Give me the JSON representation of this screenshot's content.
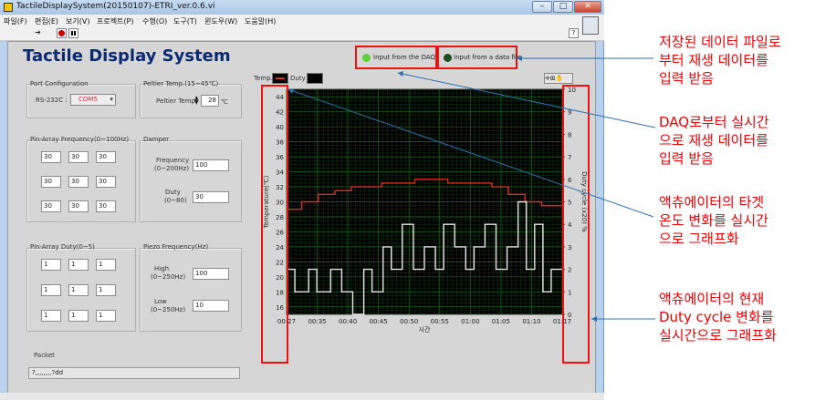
{
  "window": {
    "title": "TactileDisplaySystem(20150107)-ETRI_ver.0.6.vi",
    "min": "–",
    "max": "□",
    "close": "✕"
  },
  "menu": [
    "파일(F)",
    "편집(E)",
    "보기(V)",
    "프로젝트(P)",
    "수행(O)",
    "도구(T)",
    "윈도우(W)",
    "도움말(H)"
  ],
  "toolbar": {
    "run_icon": "arrow-run-icon",
    "stop_icon": "stop-icon",
    "pause_icon": "pause-icon",
    "help_icon": "help-icon"
  },
  "app_title": "Tactile Display System",
  "input_daq": {
    "label": "Input from the DAQ",
    "led_color": "#5fd23a"
  },
  "input_file": {
    "label": "Input from a data file",
    "led_color": "#1e4d1e"
  },
  "port_config": {
    "title": "Port Configuration",
    "label": "RS-232C :",
    "value": "COM5"
  },
  "peltier": {
    "title": "Peltier Temp.(15~45℃)",
    "label": "Peltier Temp.",
    "value": "28",
    "unit": "℃"
  },
  "pin_freq": {
    "title": "Pin-Array Frequency(0~100Hz)",
    "values": [
      "30",
      "30",
      "30",
      "30",
      "30",
      "30",
      "30",
      "30",
      "30"
    ]
  },
  "damper": {
    "title": "Damper",
    "freq_label1": "Frequency",
    "freq_label2": "(0~200Hz)",
    "freq_value": "100",
    "duty_label1": "Duty",
    "duty_label2": "(0~80)",
    "duty_value": "30"
  },
  "pin_duty": {
    "title": "Pin-Array Duty(0~5)",
    "values": [
      "1",
      "1",
      "1",
      "1",
      "1",
      "1",
      "1",
      "1",
      "1"
    ]
  },
  "piezo": {
    "title": "Piezo Frequency(Hz)",
    "high_label1": "High",
    "high_label2": "(0~250Hz)",
    "high_value": "100",
    "low_label1": "Low",
    "low_label2": "(0~250Hz)",
    "low_value": "10"
  },
  "packet": {
    "title": "Packet",
    "value": "?,,,,,,,,?dd"
  },
  "chart_legend": {
    "temp": "Temp.",
    "duty": "Duty"
  },
  "chart_data": {
    "type": "line",
    "xlabel": "시간",
    "ylabel": "Temperature(℃)",
    "y2label": "Duty cycle (x20) %",
    "xticks": [
      "00:27",
      "00:35",
      "00:40",
      "00:45",
      "00:50",
      "00:55",
      "01:00",
      "01:05",
      "01:10",
      "01:17"
    ],
    "ylim": [
      15,
      45
    ],
    "yticks": [
      16,
      18,
      20,
      22,
      24,
      26,
      28,
      30,
      32,
      34,
      36,
      38,
      40,
      42,
      44
    ],
    "y2lim": [
      0,
      10
    ],
    "y2ticks": [
      0,
      1,
      2,
      3,
      4,
      5,
      6,
      7,
      8,
      9,
      10
    ],
    "series": [
      {
        "axis": "left",
        "color": "#d9301e",
        "x": [
          0.0,
          0.055,
          0.055,
          0.115,
          0.115,
          0.175,
          0.175,
          0.235,
          0.235,
          0.345,
          0.345,
          0.465,
          0.465,
          0.585,
          0.585,
          0.745,
          0.745,
          0.805,
          0.805,
          0.865,
          0.865,
          0.925,
          0.925,
          1.0
        ],
        "y": [
          29,
          29,
          30,
          30,
          31,
          31,
          31.5,
          31.5,
          32,
          32,
          32.5,
          32.5,
          33,
          33,
          32.5,
          32.5,
          32,
          32,
          31,
          31,
          30,
          30,
          29.5,
          29.5
        ]
      },
      {
        "axis": "right",
        "color": "#e8e8e8",
        "x": [
          0.0,
          0.03,
          0.03,
          0.08,
          0.08,
          0.11,
          0.11,
          0.16,
          0.16,
          0.2,
          0.2,
          0.24,
          0.24,
          0.28,
          0.28,
          0.31,
          0.31,
          0.35,
          0.35,
          0.38,
          0.38,
          0.42,
          0.42,
          0.46,
          0.46,
          0.5,
          0.5,
          0.54,
          0.54,
          0.57,
          0.57,
          0.61,
          0.61,
          0.65,
          0.65,
          0.68,
          0.68,
          0.72,
          0.72,
          0.76,
          0.76,
          0.8,
          0.8,
          0.84,
          0.84,
          0.87,
          0.87,
          0.9,
          0.9,
          0.93,
          0.93,
          0.96,
          0.96,
          1.0
        ],
        "y": [
          2,
          2,
          1,
          1,
          2,
          2,
          1,
          1,
          2,
          2,
          1,
          1,
          0,
          0,
          2,
          2,
          1,
          1,
          3,
          3,
          2,
          2,
          4,
          4,
          2,
          2,
          3,
          3,
          2,
          2,
          4,
          4,
          3,
          3,
          2,
          2,
          3,
          3,
          4,
          4,
          2,
          2,
          3,
          3,
          5,
          5,
          2,
          2,
          4,
          4,
          1,
          1,
          2,
          2
        ]
      }
    ]
  },
  "annotations": [
    {
      "lines": [
        "저장된 데이터 파일로",
        "부터 재생 데이터를",
        "입력 받음"
      ]
    },
    {
      "lines": [
        "DAQ로부터 실시간",
        "으로 재생 데이터를",
        "입력 받음"
      ]
    },
    {
      "lines": [
        "액츄에이터의 타겟",
        "온도 변화를 실시간",
        "으로 그래프화"
      ]
    },
    {
      "lines": [
        "액츄에이터의 현재",
        "Duty cycle 변화를",
        "실시간으로 그래프화"
      ]
    }
  ]
}
